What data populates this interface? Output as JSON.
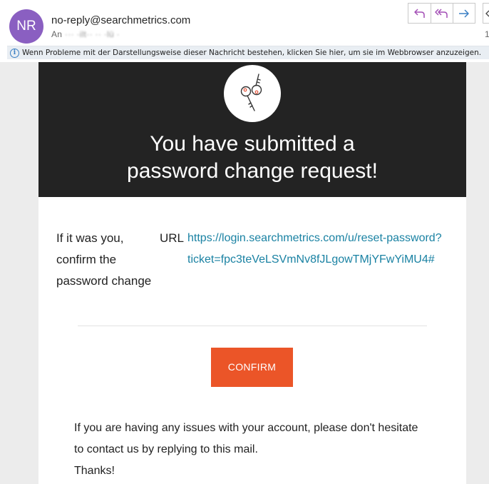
{
  "mail": {
    "avatar_initials": "NR",
    "avatar_color": "#8a5fc1",
    "sender": "no-reply@searchmetrics.com",
    "recipient_prefix": "An",
    "recipient_name": "··· ·ilt·· ·· ·lü ·",
    "date_fragment": "1",
    "actions": [
      {
        "name": "reply",
        "icon": "reply-icon"
      },
      {
        "name": "reply-all",
        "icon": "reply-all-icon"
      },
      {
        "name": "forward",
        "icon": "forward-icon"
      }
    ]
  },
  "info_bar": {
    "text": "Wenn Probleme mit der Darstellungsweise dieser Nachricht bestehen, klicken Sie hier, um sie im Webbrowser anzuzeigen."
  },
  "email": {
    "hero_icon": "keys-icon",
    "title_line1": "You have submitted a",
    "title_line2": "password change request!",
    "confirm_label_line1": "If it was you,",
    "confirm_label_line2": "confirm the",
    "confirm_label_line3": "password change",
    "url_label": "URL",
    "reset_url_line1": "https://login.searchmetrics.com/u/reset-password?",
    "reset_url_line2": "ticket=fpc3teVeLSVmNv8fJLgowTMjYFwYiMU4#",
    "confirm_button": "CONFIRM",
    "support_line1": "If you are having any issues with your account, please don't hesitate",
    "support_line2": "to contact us by replying to this mail.",
    "thanks": "Thanks!"
  },
  "colors": {
    "hero_background": "#232323",
    "button": "#eb5528",
    "link": "#1a82a3",
    "action_icon": "#a34fb5",
    "forward_icon": "#3a7fc4"
  }
}
